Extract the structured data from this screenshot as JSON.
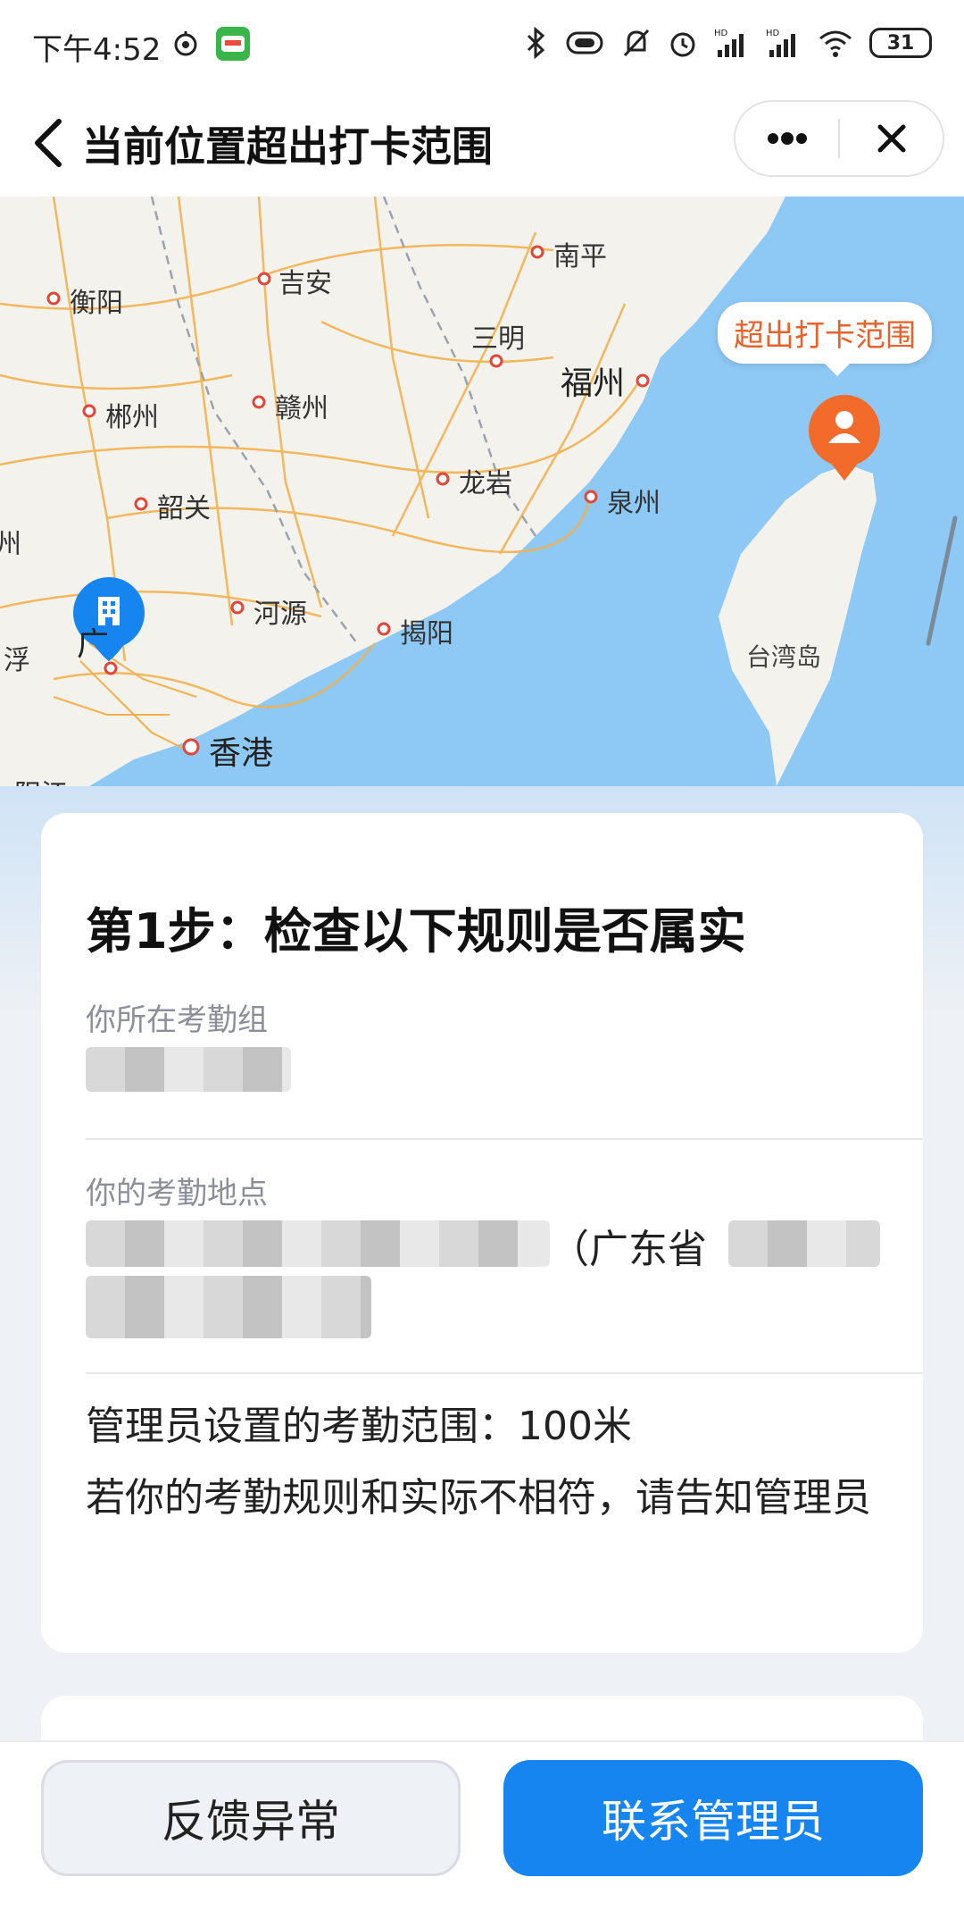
{
  "status_bar": {
    "time": "下午4:52",
    "battery": "31"
  },
  "nav": {
    "title": "当前位置超出打卡范围"
  },
  "map": {
    "labels": [
      "南平",
      "吉安",
      "衡阳",
      "三明",
      "福州",
      "郴州",
      "赣州",
      "龙岩",
      "泉州",
      "韶关",
      "河源",
      "揭阳",
      "香港",
      "阳江",
      "台湾岛",
      "广",
      "浮",
      "州"
    ],
    "callout": "超出打卡范围",
    "colors": {
      "sea": "#8ec8f5",
      "land": "#f4f2ec",
      "road": "#f3b14e",
      "border": "#9aa3ad"
    }
  },
  "card": {
    "step_title": "第1步：检查以下规则是否属实",
    "group_label": "你所在考勤组",
    "location_label": "你的考勤地点",
    "location_visible": "（广东省",
    "range_text": "管理员设置的考勤范围：100米",
    "notice_text": "若你的考勤规则和实际不相符，请告知管理员"
  },
  "buttons": {
    "feedback": "反馈异常",
    "contact": "联系管理员"
  },
  "colors": {
    "primary": "#1685f0",
    "warning": "#e8612a",
    "company_pin": "#1685f0",
    "user_pin": "#f26b2a"
  }
}
